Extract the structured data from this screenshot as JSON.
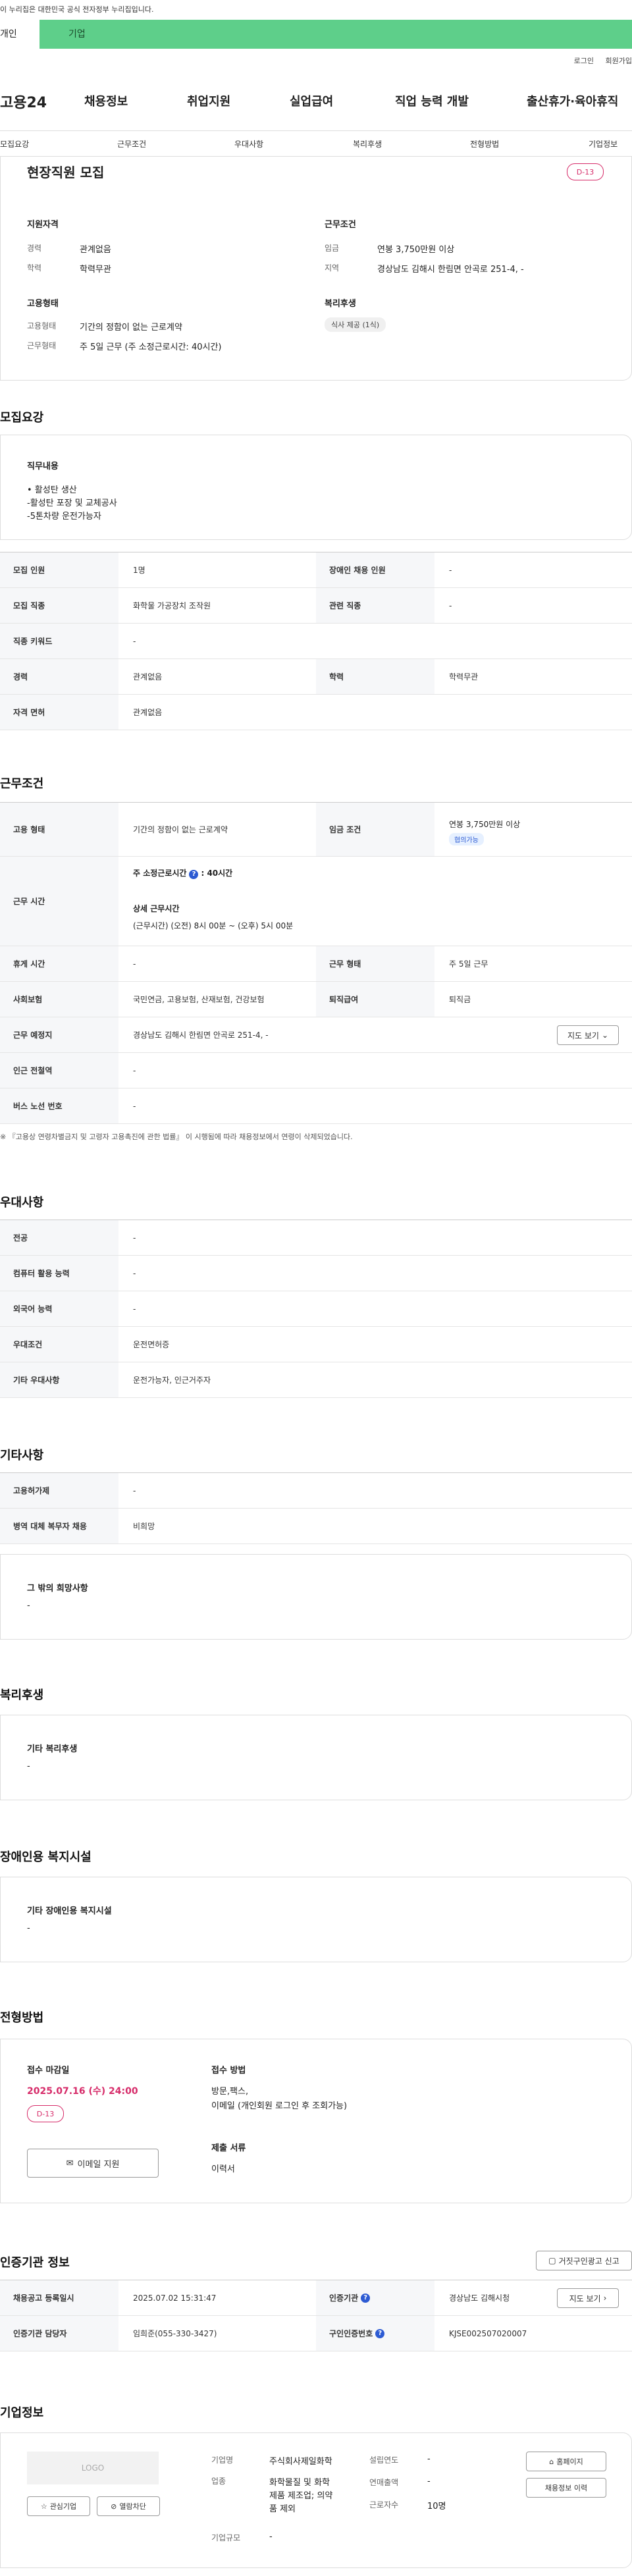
{
  "gov_banner": "이 누리집은 대한민국 공식 전자정부 누리집입니다.",
  "member_tabs": {
    "personal": "개인",
    "company": "기업"
  },
  "util": {
    "login": "로그인",
    "join": "회원가입"
  },
  "logo": "고용24",
  "gnb": [
    "채용정보",
    "취업지원",
    "실업급여",
    "직업 능력 개발",
    "출산휴가·육아휴직"
  ],
  "subnav": [
    "모집요강",
    "근무조건",
    "우대사항",
    "복리후생",
    "전형방법",
    "기업정보"
  ],
  "summary": {
    "title": "현장직원 모집",
    "dday": "D-13",
    "qual_heading": "지원자격",
    "career_label": "경력",
    "career_value": "관계없음",
    "edu_label": "학력",
    "edu_value": "학력무관",
    "cond_heading": "근무조건",
    "wage_label": "임금",
    "wage_value": "연봉 3,750만원 이상",
    "region_label": "지역",
    "region_value": "경상남도 김해시 한림면 안곡로 251-4, -",
    "emp_heading": "고용형태",
    "emp_label": "고용형태",
    "emp_value": "기간의 정함이 없는 근로계약",
    "worktype_label": "근무형태",
    "worktype_value": "주 5일 근무 (주 소정근로시간: 40시간)",
    "welfare_heading": "복리후생",
    "welfare_chip": "식사 제공 (1식)"
  },
  "recruit": {
    "heading": "모집요강",
    "duty_label": "직무내용",
    "duty_lines": [
      "• 활성탄  생산",
      "-활성탄 포장 및 교체공사",
      "-5톤차량 운전가능자"
    ],
    "rows": [
      {
        "k1": "모집 인원",
        "v1": "1명",
        "k2": "장애인 채용 인원",
        "v2": "-"
      },
      {
        "k1": "모집 직종",
        "v1": "화학물 가공장치 조작원",
        "k2": "관련 직종",
        "v2": "-"
      },
      {
        "k1": "직종 키워드",
        "v1": "-"
      },
      {
        "k1": "경력",
        "v1": "관계없음",
        "k2": "학력",
        "v2": "학력무관"
      },
      {
        "k1": "자격 면허",
        "v1": "관계없음"
      }
    ]
  },
  "work": {
    "heading": "근무조건",
    "emp_type_label": "고용 형태",
    "emp_type_value": "기간의 정함이 없는 근로계약",
    "wage_label": "임금 조건",
    "wage_value": "연봉 3,750만원 이상",
    "wage_chip": "협의가능",
    "hours_label": "근무 시간",
    "hours_week": "주 소정근로시간",
    "hours_week_value": ": 40시간",
    "hours_detail_label": "상세 근무시간",
    "hours_detail_value": "(근무시간) (오전) 8시 00분 ~ (오후) 5시 00분",
    "rest_label": "휴게 시간",
    "rest_value": "-",
    "shift_label": "근무 형태",
    "shift_value": "주 5일 근무",
    "insurance_label": "사회보험",
    "insurance_value": "국민연금, 고용보험, 산재보험, 건강보험",
    "severance_label": "퇴직급여",
    "severance_value": "퇴직금",
    "place_label": "근무 예정지",
    "place_value": "경상남도 김해시 한림면 안곡로 251-4, -",
    "map_button": "지도 보기",
    "station_label": "인근 전철역",
    "station_value": "-",
    "bus_label": "버스 노선 번호",
    "bus_value": "-",
    "note": "※ 『고용상 연령차별금지 및 고령자 고용촉진에 관한 법률』 이 시행됨에 따라 채용정보에서 연령이 삭제되었습니다."
  },
  "pref": {
    "heading": "우대사항",
    "rows": [
      {
        "k": "전공",
        "v": "-"
      },
      {
        "k": "컴퓨터 활용 능력",
        "v": "-"
      },
      {
        "k": "외국어 능력",
        "v": "-"
      },
      {
        "k": "우대조건",
        "v": "운전면허증"
      },
      {
        "k": "기타 우대사항",
        "v": "운전가능자, 인근거주자"
      }
    ]
  },
  "etc": {
    "heading": "기타사항",
    "rows": [
      {
        "k": "고용허가제",
        "v": "-"
      },
      {
        "k": "병역 대체 복무자 채용",
        "v": "비희망"
      }
    ],
    "wish_label": "그 밖의 희망사항",
    "wish_value": "-"
  },
  "welfare": {
    "heading": "복리후생",
    "label": "기타 복리후생",
    "value": "-"
  },
  "disabled": {
    "heading": "장애인용 복지시설",
    "label": "기타 장애인용 복지시설",
    "value": "-"
  },
  "screening": {
    "heading": "전형방법",
    "deadline_label": "접수 마감일",
    "deadline_value": "2025.07.16 (수) 24:00",
    "dday": "D-13",
    "email_button": "이메일 지원",
    "method_label": "접수 방법",
    "method_value1": "방문,팩스,",
    "method_value2": "이메일 (개인회원 로그인 후 조회가능)",
    "docs_label": "제출 서류",
    "docs_value": "이력서"
  },
  "cert": {
    "heading": "인증기관 정보",
    "report_button": "거짓구인광고 신고",
    "reg_label": "채용공고 등록일시",
    "reg_value": "2025.07.02 15:31:47",
    "agency_label": "인증기관",
    "agency_value": "경상남도 김해시청",
    "map_button": "지도 보기",
    "manager_label": "인증기관 담당자",
    "manager_value": "임희준(055-330-3427)",
    "offer_label": "구인인증번호",
    "offer_value": "KJSE002507020007"
  },
  "company": {
    "heading": "기업정보",
    "logo_text": "LOGO",
    "fav_button": "관심기업",
    "block_button": "열람차단",
    "name_label": "기업명",
    "name_value": "주식회사제일화학",
    "industry_label": "업종",
    "industry_value1": "화학물질 및 화학",
    "industry_value2": "제품 제조업; 의약",
    "industry_value3": "품 제외",
    "size_label": "기업규모",
    "size_value": "-",
    "founded_label": "설립연도",
    "founded_value": "-",
    "sales_label": "연매출액",
    "sales_value": "-",
    "staff_label": "근로자수",
    "staff_value": "10명",
    "homepage_button": "홈페이지",
    "history_button": "채용정보 이력"
  }
}
